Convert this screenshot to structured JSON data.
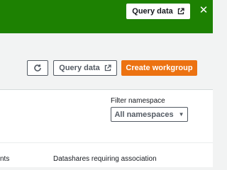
{
  "banner": {
    "query_label": "Query data",
    "close_glyph": "✕",
    "background": "#1d8102"
  },
  "toolbar": {
    "refresh_icon": "refresh-icon",
    "query_label": "Query data",
    "create_label": "Create workgroup",
    "create_color": "#ec7211"
  },
  "filter": {
    "label": "Filter namespace",
    "selected": "All namespaces"
  },
  "table": {
    "columns": [
      "nts",
      "Datashares requiring association"
    ]
  }
}
